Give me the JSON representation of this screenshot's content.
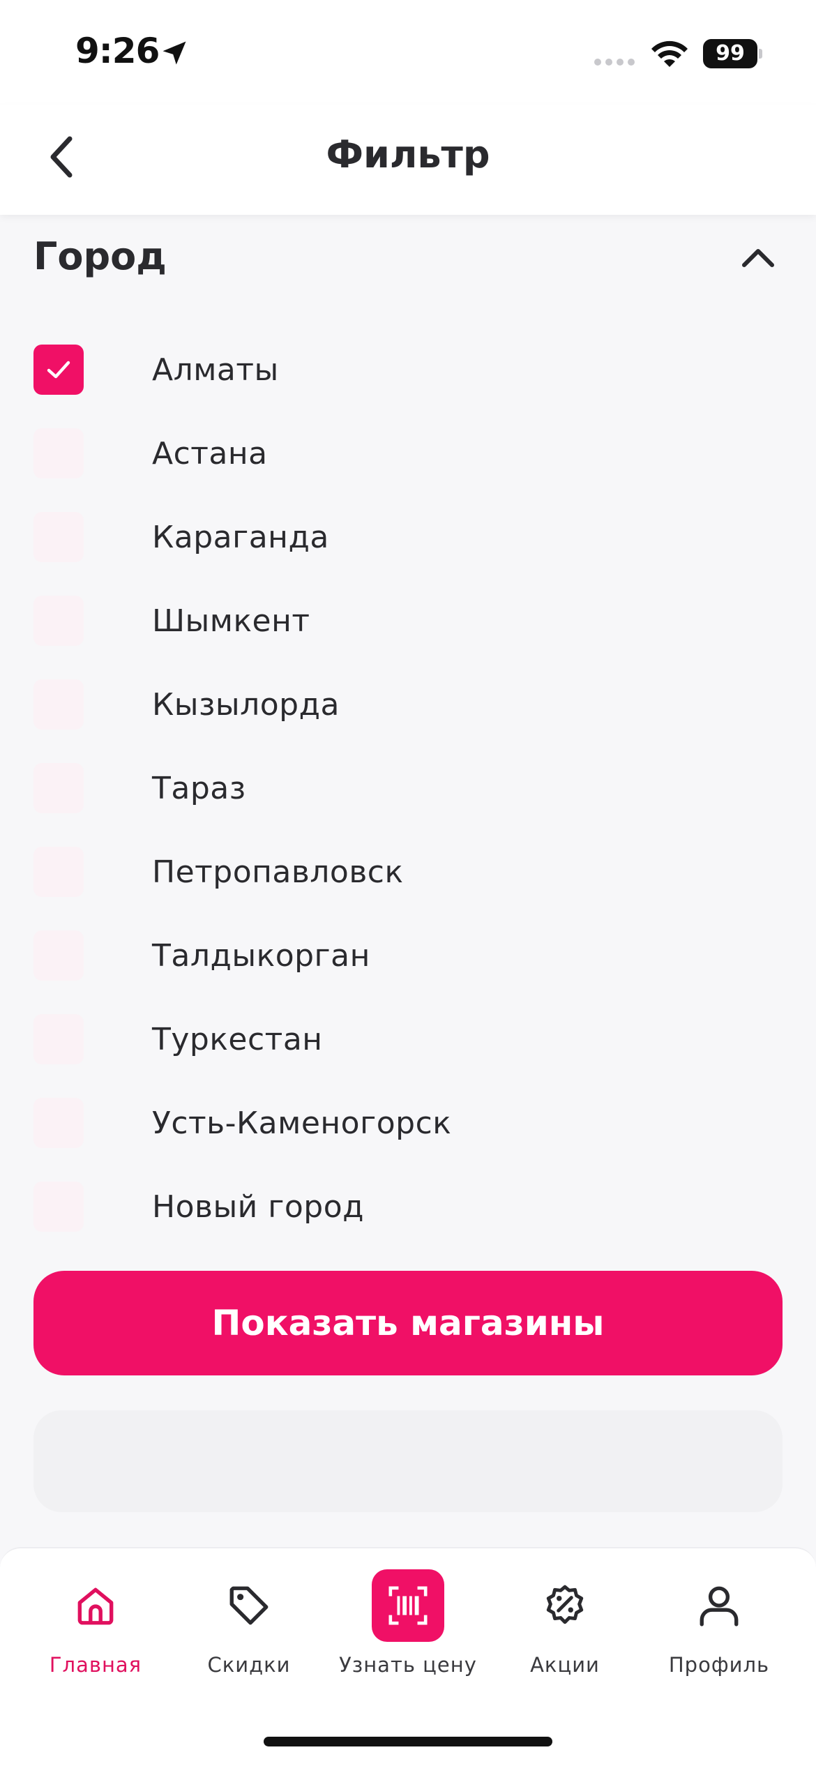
{
  "status_bar": {
    "time": "9:26",
    "battery": "99"
  },
  "header": {
    "title": "Фильтр"
  },
  "section": {
    "title": "Город"
  },
  "cities": [
    {
      "label": "Алматы",
      "checked": true
    },
    {
      "label": "Астана",
      "checked": false
    },
    {
      "label": "Караганда",
      "checked": false
    },
    {
      "label": "Шымкент",
      "checked": false
    },
    {
      "label": "Кызылорда",
      "checked": false
    },
    {
      "label": "Тараз",
      "checked": false
    },
    {
      "label": "Петропавловск",
      "checked": false
    },
    {
      "label": "Талдыкорган",
      "checked": false
    },
    {
      "label": "Туркестан",
      "checked": false
    },
    {
      "label": "Усть-Каменогорск",
      "checked": false
    },
    {
      "label": "Новый город",
      "checked": false
    }
  ],
  "actions": {
    "show_stores": "Показать магазины"
  },
  "tabs": [
    {
      "label": "Главная",
      "icon": "home-icon",
      "active": true
    },
    {
      "label": "Скидки",
      "icon": "tag-icon",
      "active": false
    },
    {
      "label": "Узнать цену",
      "icon": "barcode-scan-icon",
      "active": false
    },
    {
      "label": "Акции",
      "icon": "percent-badge-icon",
      "active": false
    },
    {
      "label": "Профиль",
      "icon": "profile-icon",
      "active": false
    }
  ],
  "colors": {
    "accent": "#f01066",
    "background": "#f7f7f9",
    "text": "#2a2a2e"
  }
}
